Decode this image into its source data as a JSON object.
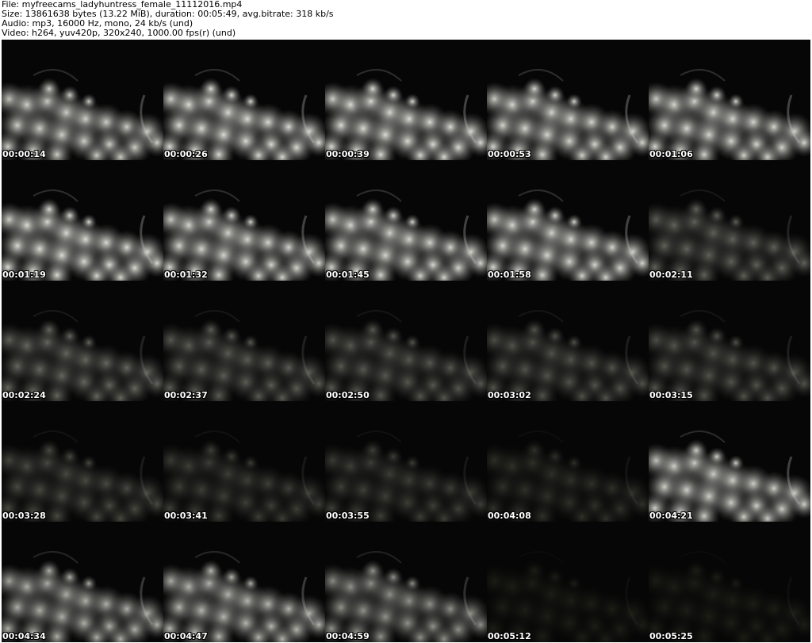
{
  "header": {
    "file_line": "File: myfreecams_ladyhuntress_female_11112016.mp4",
    "size_line": "Size: 13861638 bytes (13.22 MiB), duration: 00:05:49, avg.bitrate: 318 kb/s",
    "audio_line": "Audio: mp3, 16000 Hz, mono, 24 kb/s (und)",
    "video_line": "Video: h264, yuv420p, 320x240, 1000.00 fps(r) (und)"
  },
  "frames": [
    {
      "timestamp": "00:00:14",
      "brightness": 0.85
    },
    {
      "timestamp": "00:00:26",
      "brightness": 0.9
    },
    {
      "timestamp": "00:00:39",
      "brightness": 0.9
    },
    {
      "timestamp": "00:00:53",
      "brightness": 0.88
    },
    {
      "timestamp": "00:01:06",
      "brightness": 0.88
    },
    {
      "timestamp": "00:01:19",
      "brightness": 0.9
    },
    {
      "timestamp": "00:01:32",
      "brightness": 0.88
    },
    {
      "timestamp": "00:01:45",
      "brightness": 0.88
    },
    {
      "timestamp": "00:01:58",
      "brightness": 0.88
    },
    {
      "timestamp": "00:02:11",
      "brightness": 0.4
    },
    {
      "timestamp": "00:02:24",
      "brightness": 0.42
    },
    {
      "timestamp": "00:02:37",
      "brightness": 0.38
    },
    {
      "timestamp": "00:02:50",
      "brightness": 0.36
    },
    {
      "timestamp": "00:03:02",
      "brightness": 0.34
    },
    {
      "timestamp": "00:03:15",
      "brightness": 0.34
    },
    {
      "timestamp": "00:03:28",
      "brightness": 0.3
    },
    {
      "timestamp": "00:03:41",
      "brightness": 0.26
    },
    {
      "timestamp": "00:03:55",
      "brightness": 0.26
    },
    {
      "timestamp": "00:04:08",
      "brightness": 0.2
    },
    {
      "timestamp": "00:04:21",
      "brightness": 0.85
    },
    {
      "timestamp": "00:04:34",
      "brightness": 0.72
    },
    {
      "timestamp": "00:04:47",
      "brightness": 0.75
    },
    {
      "timestamp": "00:04:59",
      "brightness": 0.6
    },
    {
      "timestamp": "00:05:12",
      "brightness": 0.12
    },
    {
      "timestamp": "00:05:25",
      "brightness": 0.12
    }
  ]
}
